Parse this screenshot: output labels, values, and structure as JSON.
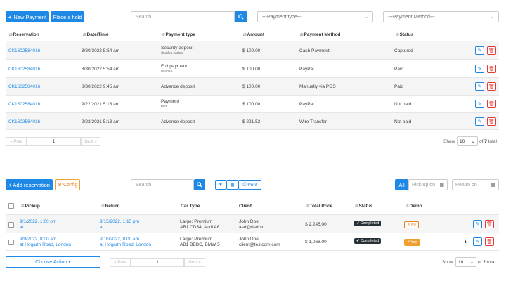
{
  "payments": {
    "new_payment_label": "New Payment",
    "place_hold_label": "Place a hold",
    "search_placeholder": "Search",
    "payment_type_select": "---Payment type---",
    "payment_method_select": "---Payment Method---",
    "columns": [
      "Reservation",
      "Date/Time",
      "Payment type",
      "Amount",
      "Payment Method",
      "Status"
    ],
    "rows": [
      {
        "reservation": "CK1602584016",
        "datetime": "8/30/2022 5:54 am",
        "type": "Security deposit",
        "type_sub": "dsadsa sadsa",
        "amount": "$ 100.00",
        "method": "Cash Payment",
        "status": "Captured"
      },
      {
        "reservation": "CK1602584016",
        "datetime": "8/30/2022 5:54 am",
        "type": "Full payment",
        "type_sub": "dsadsa",
        "amount": "$ 100.00",
        "method": "PayPal",
        "status": "Paid"
      },
      {
        "reservation": "CK1602584016",
        "datetime": "8/30/2022 9:45 am",
        "type": "Advance deposit",
        "type_sub": "",
        "amount": "$ 100.00",
        "method": "Manually via POS",
        "status": "Paid"
      },
      {
        "reservation": "CK1602584016",
        "datetime": "9/22/2021 5:13 am",
        "type": "Payment",
        "type_sub": "test",
        "amount": "$ 100.00",
        "method": "PayPal",
        "status": "Not paid"
      },
      {
        "reservation": "CK1602584016",
        "datetime": "9/22/2021 5:13 am",
        "type": "Advance deposit",
        "type_sub": "",
        "amount": "$ 221.52",
        "method": "Wire Transfer",
        "status": "Not paid"
      }
    ],
    "pager": {
      "prev": "« Prev",
      "page": "1",
      "next": "Next »",
      "show_label": "Show",
      "show_value": "10",
      "of_label": "of",
      "total_pages": "7",
      "total_label": "total"
    }
  },
  "reservations": {
    "add_label": "Add reservation",
    "config_label": "Config",
    "search_placeholder": "Search",
    "print_label": "Print",
    "all_label": "All",
    "pickup_on_placeholder": "Pick-up on",
    "return_on_placeholder": "Return on",
    "columns": [
      "Pickup",
      "Return",
      "Car Type",
      "Client",
      "Total Price",
      "Status",
      "Demo"
    ],
    "rows": [
      {
        "pickup_date": "9/1/2022, 1:00 pm",
        "pickup_loc": "at",
        "return_date": "9/15/2022, 1:15 pm",
        "return_loc": "at",
        "car1": "Large: Premium",
        "car2": "AB1 CD34, Audi A6",
        "client1": "John Doe",
        "client2": "asd@dsd.sd",
        "price": "$ 2,245.00",
        "status": "Completed",
        "demo": "No"
      },
      {
        "pickup_date": "9/9/2022, 8:00 am",
        "pickup_loc": "at Hogarth Road, London",
        "return_date": "9/16/2022, 8:00 am",
        "return_loc": "at Hogarth Road, London",
        "car1": "Large: Premium",
        "car2": "AB1 BBBC, BMW 5",
        "client1": "John Doe",
        "client2": "client@testcom.com",
        "price": "$ 1,068.00",
        "status": "Completed",
        "demo": "Yes"
      }
    ],
    "choose_action": "Choose Action",
    "pager": {
      "prev": "« Prev",
      "page": "1",
      "next": "Next »",
      "show_label": "Show",
      "show_value": "10",
      "of_label": "of",
      "total_pages": "2",
      "total_label": "total"
    }
  },
  "colors": {
    "accent": "#1e88e5",
    "danger": "#e53935",
    "dark_badge": "#263238",
    "demo_no": "#e67e22",
    "demo_yes": "#f0a030"
  }
}
